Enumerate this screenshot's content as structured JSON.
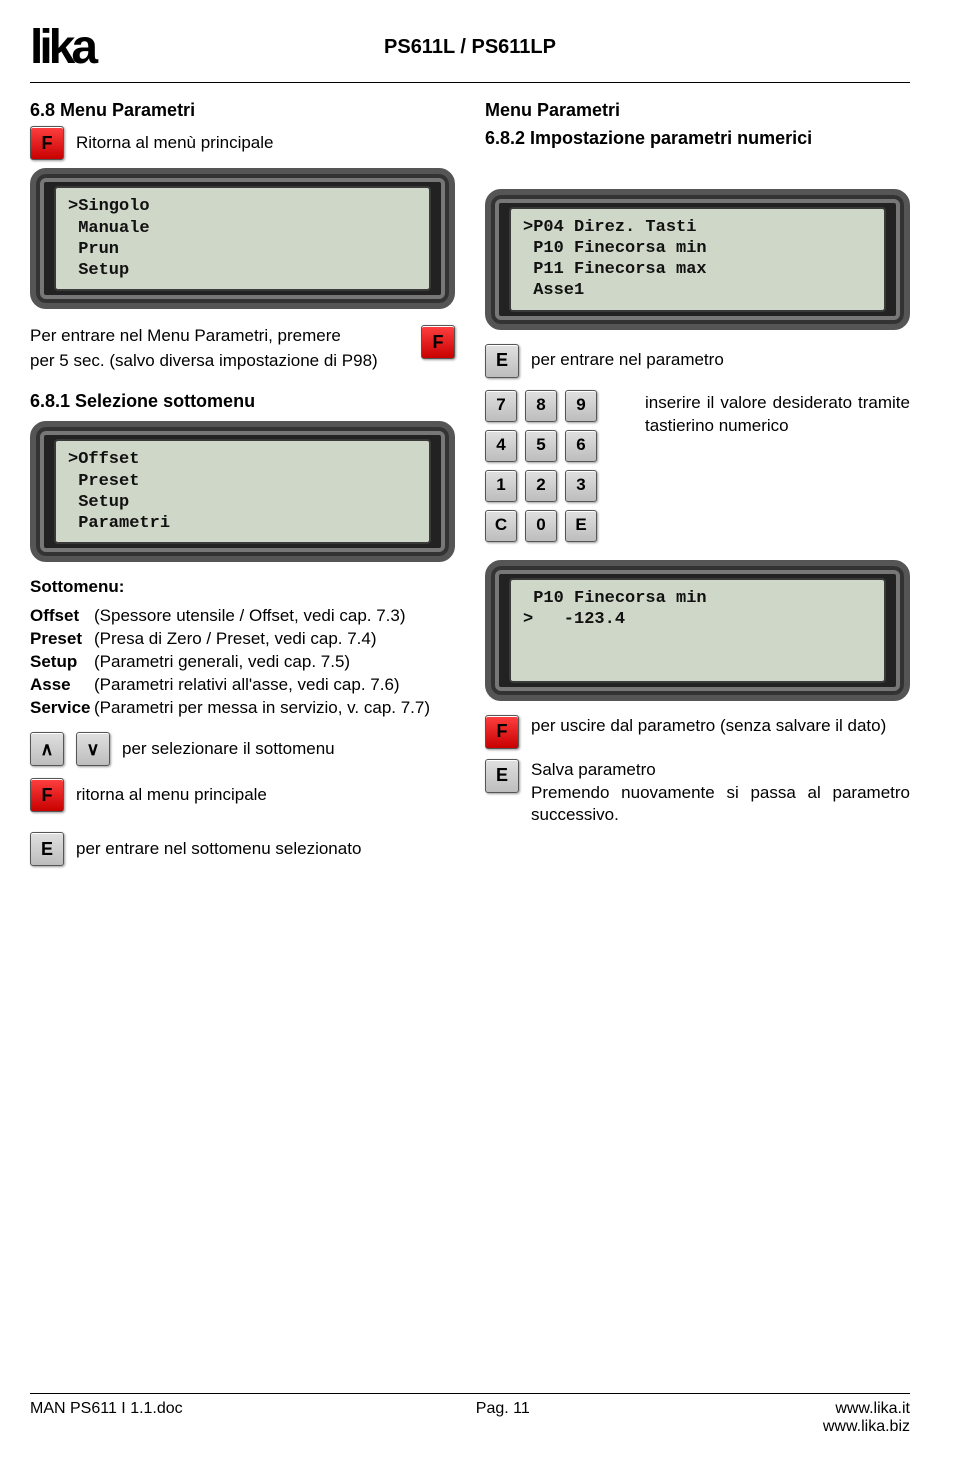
{
  "header": {
    "logo": "lika",
    "model": "PS611L / PS611LP"
  },
  "left": {
    "h1": "6.8 Menu Parametri",
    "return_main": "Ritorna al menù principale",
    "lcd1": ">Singolo\n Manuale\n Prun\n Setup",
    "enter_menu_p1": "Per entrare nel Menu Parametri, premere",
    "enter_menu_p2": "per 5 sec. (salvo diversa impostazione di P98)",
    "h2": "6.8.1 Selezione sottomenu",
    "lcd2": ">Offset\n Preset\n Setup\n Parametri",
    "sub_h": "Sottomenu:",
    "sub": [
      {
        "label": "Offset",
        "desc": "(Spessore utensile / Offset, vedi cap. 7.3)"
      },
      {
        "label": "Preset",
        "desc": "(Presa di Zero / Preset, vedi cap. 7.4)"
      },
      {
        "label": "Setup",
        "desc": "(Parametri generali, vedi cap. 7.5)"
      },
      {
        "label": "Asse",
        "desc": "(Parametri relativi all'asse, vedi cap. 7.6)"
      },
      {
        "label": "Service",
        "desc": "(Parametri per messa in servizio, v. cap. 7.7)"
      }
    ],
    "select_sub": "per selezionare il sottomenu",
    "return_menu": "ritorna al menu principale",
    "enter_sub": "per entrare nel sottomenu selezionato"
  },
  "right": {
    "h1a": "Menu Parametri",
    "h1b": "6.8.2 Impostazione parametri numerici",
    "lcd1": ">P04 Direz. Tasti\n P10 Finecorsa min\n P11 Finecorsa max\n Asse1",
    "enter_param": "per entrare nel parametro",
    "enter_value": "inserire il valore desiderato tramite tastierino numerico",
    "keypad": {
      "r1": [
        "7",
        "8",
        "9"
      ],
      "r2": [
        "4",
        "5",
        "6"
      ],
      "r3": [
        "1",
        "2",
        "3"
      ],
      "r4": [
        "C",
        "0",
        "E"
      ]
    },
    "lcd2": " P10 Finecorsa min\n>   -123.4\n \n ",
    "exit_param": "per uscire dal parametro (senza salvare il dato)",
    "save_param": "Salva parametro\nPremendo nuovamente si passa al parametro successivo."
  },
  "footer": {
    "doc": "MAN PS611 I 1.1.doc",
    "page": "Pag. 11",
    "url1": "www.lika.it",
    "url2": "www.lika.biz"
  },
  "keys": {
    "F": "F",
    "E": "E",
    "up": "∧",
    "down": "∨"
  }
}
